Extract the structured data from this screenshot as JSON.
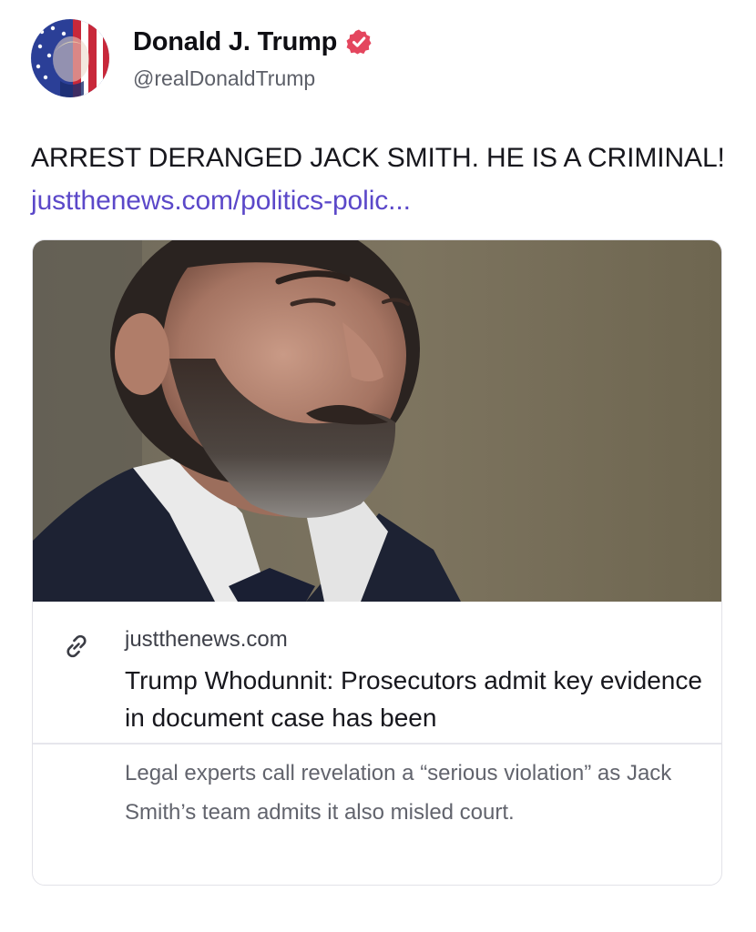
{
  "post": {
    "author": {
      "display_name": "Donald J. Trump",
      "handle": "@realDonaldTrump",
      "verified": true,
      "avatar_icon": "avatar-flag-portrait"
    },
    "text": "ARREST DERANGED JACK SMITH. HE IS A CRIMINAL!",
    "link_text": "justthenews.com/politics-polic...",
    "link_card": {
      "image_alt": "photo",
      "link_icon": "link-icon",
      "domain": "justthenews.com",
      "title": "Trump Whodunnit: Prosecutors admit key evidence in document case has been",
      "description": "Legal experts call revelation a “serious violation” as Jack Smith’s team admits it also misled court."
    }
  },
  "colors": {
    "accent_link": "#5b48c9",
    "verified_badge": "#e4465e",
    "text_primary": "#17171d",
    "text_secondary": "#5c5f68"
  }
}
